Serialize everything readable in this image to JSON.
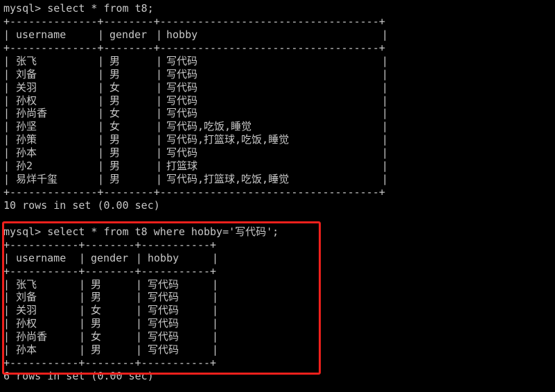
{
  "highlight_color": "#f0201c",
  "queries": [
    {
      "prompt": "mysql> select * from t8;",
      "border": "+--------------+--------+-----------------------------------+",
      "columns": [
        "username",
        "gender",
        "hobby"
      ],
      "rows": [
        [
          "张飞",
          "男",
          "写代码"
        ],
        [
          "刘备",
          "男",
          "写代码"
        ],
        [
          "关羽",
          "女",
          "写代码"
        ],
        [
          "孙权",
          "男",
          "写代码"
        ],
        [
          "孙尚香",
          "女",
          "写代码"
        ],
        [
          "孙坚",
          "女",
          "写代码,吃饭,睡觉"
        ],
        [
          "孙策",
          "男",
          "写代码,打篮球,吃饭,睡觉"
        ],
        [
          "孙本",
          "男",
          "写代码"
        ],
        [
          "孙2",
          "男",
          "打篮球"
        ],
        [
          "易烊千玺",
          "男",
          "写代码,打篮球,吃饭,睡觉"
        ]
      ],
      "footer": "10 rows in set (0.00 sec)",
      "highlighted": false
    },
    {
      "prompt": "mysql> select * from t8 where hobby='写代码';",
      "border": "+-----------+--------+-----------+",
      "columns": [
        "username",
        "gender",
        "hobby"
      ],
      "rows": [
        [
          "张飞",
          "男",
          "写代码"
        ],
        [
          "刘备",
          "男",
          "写代码"
        ],
        [
          "关羽",
          "女",
          "写代码"
        ],
        [
          "孙权",
          "男",
          "写代码"
        ],
        [
          "孙尚香",
          "女",
          "写代码"
        ],
        [
          "孙本",
          "男",
          "写代码"
        ]
      ],
      "footer": "6 rows in set (0.00 sec)",
      "highlighted": true
    }
  ]
}
